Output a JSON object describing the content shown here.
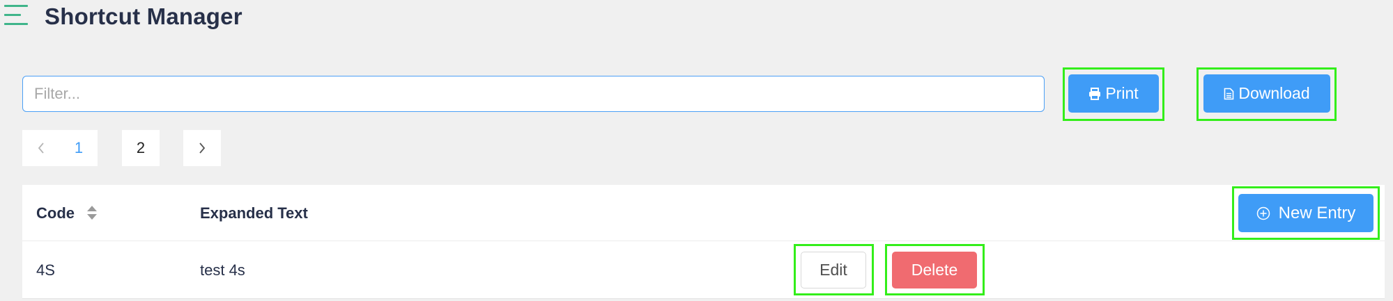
{
  "header": {
    "menu_icon": "hamburger-menu-icon",
    "title": "Shortcut Manager"
  },
  "filter": {
    "placeholder": "Filter...",
    "value": ""
  },
  "toolbar": {
    "print_label": "Print",
    "print_icon": "printer-icon",
    "download_label": "Download",
    "download_icon": "document-icon"
  },
  "pagination": {
    "pages": [
      "1",
      "2"
    ],
    "current_page": "1",
    "prev_icon": "chevron-left-icon",
    "next_icon": "chevron-right-icon"
  },
  "table": {
    "columns": [
      "Code",
      "Expanded Text"
    ],
    "sort_icon": "sort-icon",
    "new_entry_label": "New Entry",
    "new_entry_icon": "plus-circle-icon",
    "rows": [
      {
        "code": "4S",
        "expanded_text": "test 4s",
        "edit_label": "Edit",
        "delete_label": "Delete"
      }
    ]
  },
  "colors": {
    "primary": "#3f9cf7",
    "danger": "#f06b70",
    "brand_green": "#3fb58a",
    "highlight": "#33ee1a",
    "background": "#f0f0f0"
  }
}
